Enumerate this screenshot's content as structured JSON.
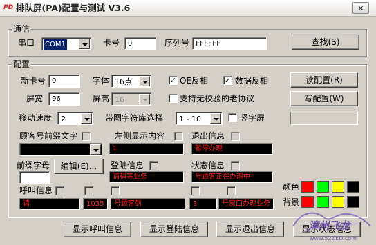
{
  "window": {
    "app_icon": "PD",
    "title": "排队屏(PA)配置与测试 V3.6",
    "close_icon": "×"
  },
  "comm": {
    "legend": "通信",
    "port_label": "串口",
    "port_value": "COM1",
    "card_label": "卡号",
    "card_value": "0",
    "serial_label": "序列号",
    "serial_value": "FFFFFF",
    "find_button": "查找(S)"
  },
  "config": {
    "legend": "配置",
    "new_card_label": "新卡号",
    "new_card_value": "0",
    "font_label": "字体",
    "font_value": "16点",
    "oe_invert": {
      "label": "OE反相",
      "checked": true
    },
    "data_invert": {
      "label": "数据反相",
      "checked": true
    },
    "read_config_button": "读配置(R)",
    "width_label": "屏宽",
    "width_value": "96",
    "height_label": "屏高",
    "height_value": "16",
    "legacy_protocol": {
      "label": "支持无校验的老协议",
      "checked": false
    },
    "write_config_button": "写配置(W)",
    "speed_label": "移动速度",
    "speed_value": "2",
    "charlib_label": "带图字符库选择",
    "charlib_value": "1 - 10",
    "vertical_screen": {
      "label": "竖字屏",
      "checked": false
    },
    "prefix_label": "顾客号前缀文字",
    "prefix_value": "",
    "left_content_label": "左侧显示内容",
    "left_content_value": "1",
    "exit_info_label": "退出信息",
    "exit_info_value": "暂停办理",
    "prefix_letter_label": "前缀字母",
    "edit_button": "编辑(E)...",
    "login_info_label": "登陆信息",
    "login_info_value": "请稍等业务",
    "status_info_label": "状态信息",
    "status_info_value": "号顾客正在办理中",
    "call_info_label": "呼叫信息",
    "call_fields": [
      "请",
      "1035",
      "号顾客到",
      "3",
      "号窗口办理业务"
    ],
    "color_label": "颜色",
    "background_label": "背景",
    "text_colors": [
      "#ff0000",
      "#00ff00",
      "#ffff00",
      "#000000"
    ],
    "bg_colors": [
      "#ff0000",
      "#00ff00",
      "#ffff00",
      "#000000"
    ]
  },
  "actions": {
    "show_call": "显示呼叫信息",
    "show_login": "显示登陆信息",
    "show_exit": "显示退出信息",
    "show_status": "显示状态信息"
  },
  "watermark": {
    "text": "漳州飞龙",
    "url": "www.52ZED.com"
  }
}
